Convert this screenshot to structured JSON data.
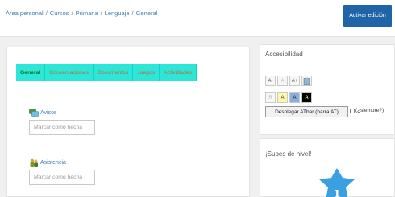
{
  "breadcrumb": {
    "items": [
      "Área personal",
      "Cursos",
      "Primaria",
      "Lenguaje",
      "General"
    ],
    "separator": "/"
  },
  "header": {
    "edit_button": "Activar edición"
  },
  "course": {
    "tabs": [
      {
        "label": "General",
        "active": true
      },
      {
        "label": "Conversaciones",
        "active": false
      },
      {
        "label": "Documentos",
        "active": false
      },
      {
        "label": "Juegos",
        "active": false
      },
      {
        "label": "Actividades",
        "active": false
      }
    ],
    "activities": [
      {
        "name": "Avisos",
        "icon": "forum-icon",
        "button": "Marcar como hecha"
      },
      {
        "name": "Asistencia",
        "icon": "attendance-icon",
        "button": "Marcar como hecha"
      }
    ]
  },
  "accessibility": {
    "title": "Accesibilidad",
    "font_buttons": [
      "A-",
      "A",
      "A+"
    ],
    "color_buttons": [
      "R",
      "A",
      "A",
      "A"
    ],
    "atbar_button": "Desplegar ATbar (barra AT)",
    "always_label": "(¿siempre?)"
  },
  "levelup": {
    "title": "¡Subes de nivel!",
    "level": "1"
  },
  "colors": {
    "tab_bg": "#2ce6d8",
    "primary_button": "#1f64a6",
    "level_badge": "#3aa0df"
  }
}
